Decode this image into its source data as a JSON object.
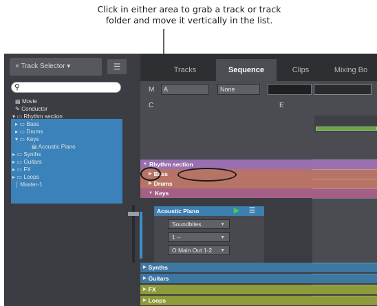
{
  "caption": {
    "line1": "Click in either area to grab a track or track",
    "line2": "folder and move it vertically in the list."
  },
  "track_selector": {
    "tab_label": "× Track Selector ▾",
    "menu_icon": "hamburger-icon",
    "search_icon": "search-icon",
    "tree": [
      {
        "label": "Movie",
        "indent": 1,
        "icon": "▤",
        "selected": false
      },
      {
        "label": "Conductor",
        "indent": 1,
        "icon": "✎",
        "selected": false
      },
      {
        "label": "Rhythm section",
        "indent": 0,
        "icon": "▾ ▭",
        "selected": true
      },
      {
        "label": "Bass",
        "indent": 1,
        "icon": "▸ ▭",
        "selected": true
      },
      {
        "label": "Drums",
        "indent": 1,
        "icon": "▸ ▭",
        "selected": true
      },
      {
        "label": "Keys",
        "indent": 1,
        "icon": "▾ ▭",
        "selected": true
      },
      {
        "label": "Acoustic Piano",
        "indent": 3,
        "icon": "▤",
        "selected": true
      },
      {
        "label": "Synths",
        "indent": 0,
        "icon": "▸ ▭",
        "selected": true
      },
      {
        "label": "Guitars",
        "indent": 0,
        "icon": "▸ ▭",
        "selected": true
      },
      {
        "label": "FX",
        "indent": 0,
        "icon": "▸ ▭",
        "selected": true
      },
      {
        "label": "Loops",
        "indent": 0,
        "icon": "▸ ▭",
        "selected": true
      },
      {
        "label": "Master-1",
        "indent": 1,
        "icon": "⌠",
        "selected": true
      }
    ]
  },
  "tabs": [
    {
      "label": "Tracks",
      "active": false
    },
    {
      "label": "Sequence",
      "active": true
    },
    {
      "label": "Clips",
      "active": false
    },
    {
      "label": "Mixing Bo",
      "active": false
    }
  ],
  "toolbar": {
    "m_label": "M",
    "a_label": "A",
    "c_label": "C",
    "e_label": "E",
    "none_value": "None"
  },
  "tracks": [
    {
      "label": "Rhythm section",
      "color": "#9a6fb0"
    },
    {
      "label": "Bass",
      "color": "#b77466"
    },
    {
      "label": "Drums",
      "color": "#b77466"
    },
    {
      "label": "Keys",
      "color": "#a35f86"
    },
    {
      "label": "Synths",
      "color": "#3d78a3"
    },
    {
      "label": "Guitars",
      "color": "#3d78a3"
    },
    {
      "label": "FX",
      "color": "#8f9a3a"
    },
    {
      "label": "Loops",
      "color": "#8f9a3a"
    }
  ],
  "instrument": {
    "name": "Acoustic Piano",
    "soundbite": "Soundbites",
    "channel": "1 --",
    "output": "O Main Out 1-2"
  },
  "colors": {
    "selection": "#3a82b9",
    "panel": "#3b3d42"
  }
}
